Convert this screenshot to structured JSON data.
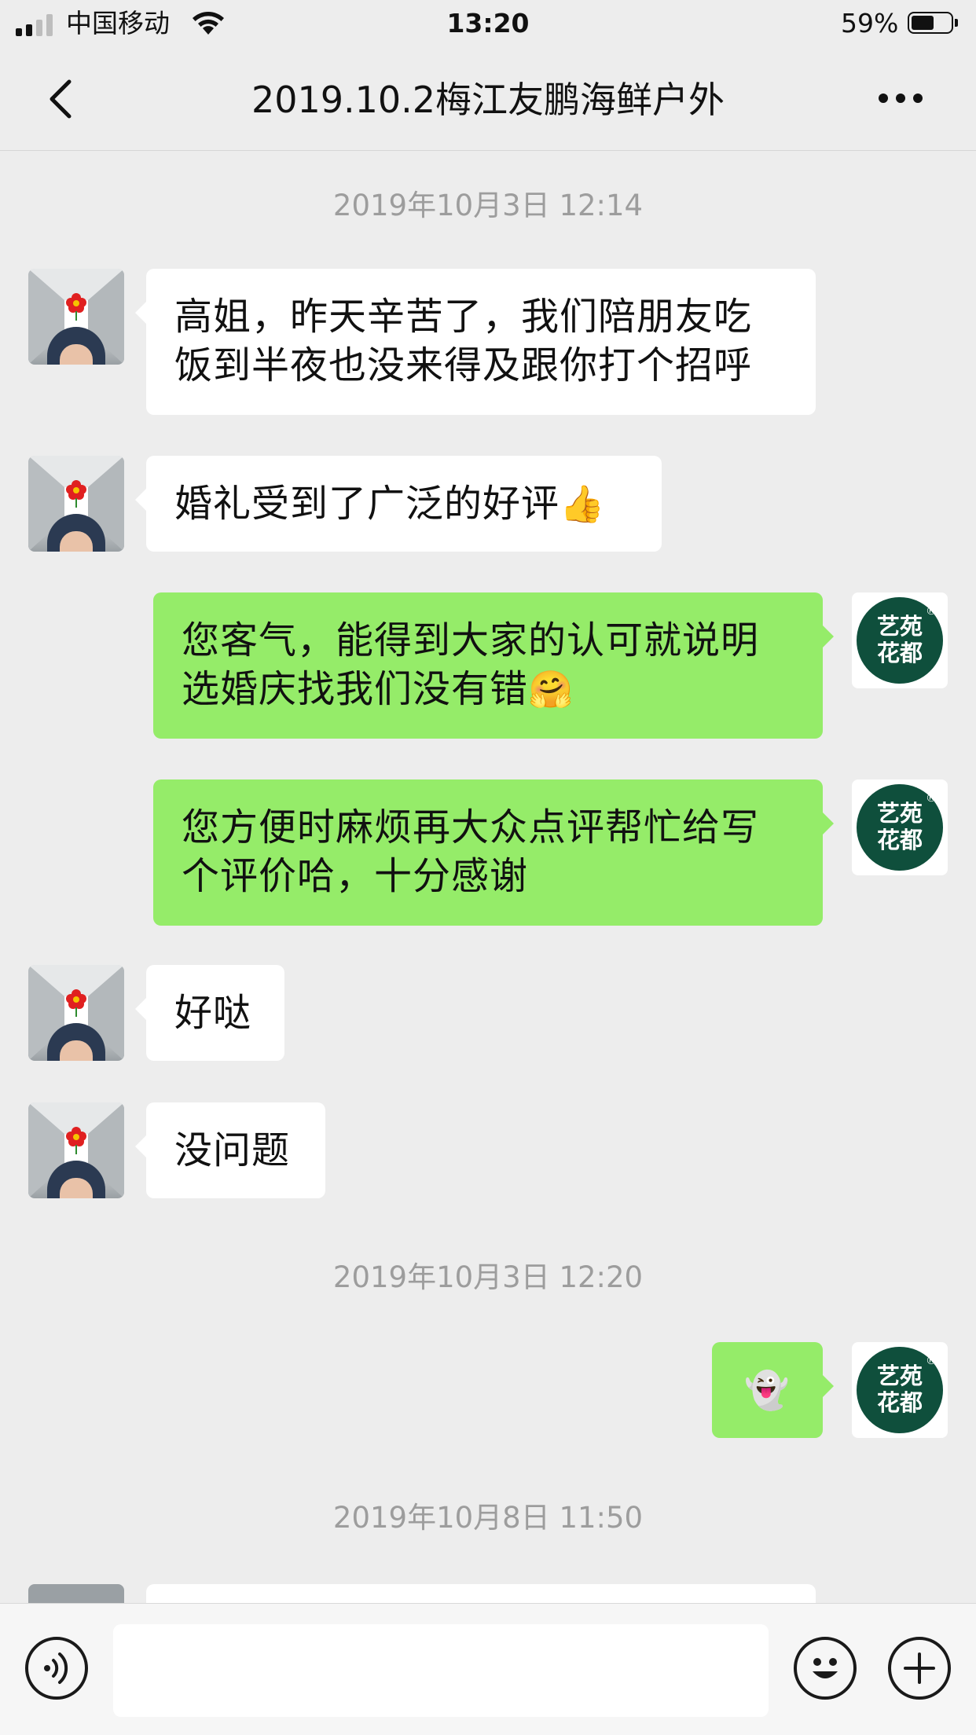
{
  "status_bar": {
    "carrier": "中国移动",
    "time": "13:20",
    "battery_percent_text": "59%",
    "battery_level": 0.59,
    "signal_bars_active": 2,
    "signal_bars_total": 4
  },
  "nav": {
    "title": "2019.10.2梅江友鹏海鲜户外",
    "back_icon": "chevron-left-icon",
    "more_icon": "more-dots-icon"
  },
  "timestamps": [
    "2019年10月3日 12:14",
    "2019年10月3日 12:20",
    "2019年10月8日 11:50"
  ],
  "messages": [
    {
      "side": "in",
      "line1": "高姐，昨天辛苦了，我们陪朋友吃",
      "line2": "饭到半夜也没来得及跟你打个招呼"
    },
    {
      "side": "in",
      "text": "婚礼受到了广泛的好评",
      "emoji": "👍"
    },
    {
      "side": "out",
      "line1": "您客气，能得到大家的认可就说明",
      "line2": "选婚庆找我们没有错",
      "emoji": "🤗"
    },
    {
      "side": "out",
      "line1": "您方便时麻烦再大众点评帮忙给写",
      "line2": "个评价哈，十分感谢"
    },
    {
      "side": "in",
      "text": "好哒"
    },
    {
      "side": "in",
      "text": "没问题"
    },
    {
      "side": "out",
      "emoji": "👻"
    }
  ],
  "avatars": {
    "contact": "contact-avatar",
    "me_logo_line1": "艺苑",
    "me_logo_line2": "花都",
    "me_logo_mark": "®"
  },
  "input_bar": {
    "voice_icon": "voice-icon",
    "emoji_icon": "emoji-icon",
    "plus_icon": "plus-icon",
    "placeholder": ""
  },
  "colors": {
    "background": "#ededed",
    "outgoing_bubble": "#95ec69",
    "incoming_bubble": "#ffffff",
    "logo_green": "#0f4f3c",
    "timestamp_gray": "#9d9d9d"
  }
}
